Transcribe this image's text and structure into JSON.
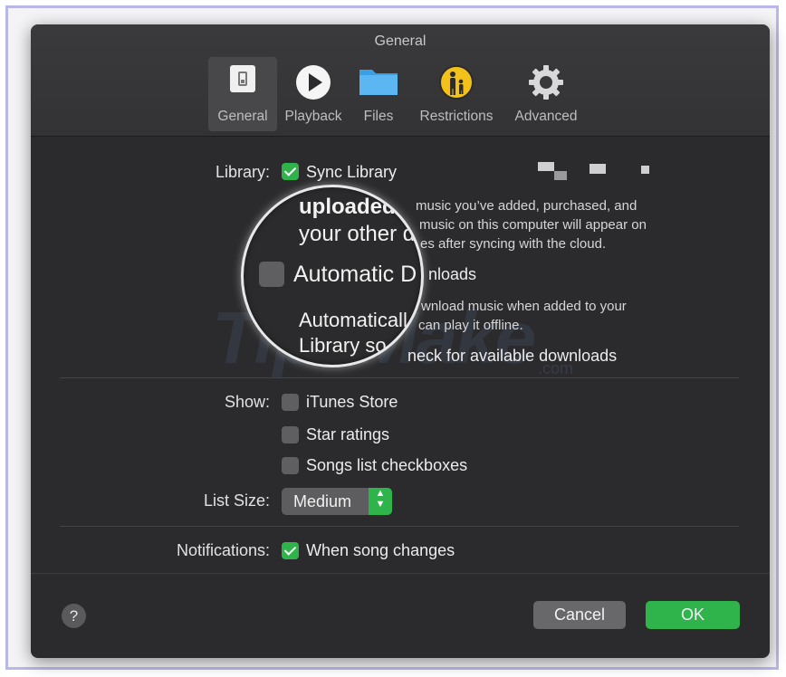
{
  "window": {
    "title": "General"
  },
  "tabs": [
    {
      "label": "General",
      "icon": "switch-icon"
    },
    {
      "label": "Playback",
      "icon": "play-icon"
    },
    {
      "label": "Files",
      "icon": "folder-icon"
    },
    {
      "label": "Restrictions",
      "icon": "parental-icon"
    },
    {
      "label": "Advanced",
      "icon": "gear-icon"
    }
  ],
  "library": {
    "label": "Library:",
    "sync_label": "Sync Library",
    "desc_line1": "music you’ve added, purchased, and",
    "desc_line2": "music on this computer will appear on",
    "desc_line3": "es after syncing with the cloud.",
    "auto_downloads_label": "nloads",
    "auto_desc_line1": "wnload music when added to your",
    "auto_desc_line2": "can play it offline.",
    "check_downloads_label": "neck for available downloads"
  },
  "magnifier": {
    "line1": "uploaded.",
    "line2": "your other d",
    "checkbox_label": "Automatic D",
    "line4": "Automaticall",
    "line5": "Library so"
  },
  "show": {
    "label": "Show:",
    "options": [
      {
        "label": "iTunes Store",
        "checked": false
      },
      {
        "label": "Star ratings",
        "checked": false
      },
      {
        "label": "Songs list checkboxes",
        "checked": false
      }
    ]
  },
  "list_size": {
    "label": "List Size:",
    "value": "Medium"
  },
  "notifications": {
    "label": "Notifications:",
    "option": "When song changes",
    "checked": true
  },
  "buttons": {
    "help": "?",
    "cancel": "Cancel",
    "ok": "OK"
  },
  "watermark": {
    "text": "TipsMake",
    "sub": ".com"
  },
  "colors": {
    "accent": "#2fb34b",
    "background": "#2b2b2d",
    "toolbar": "#38383a"
  }
}
